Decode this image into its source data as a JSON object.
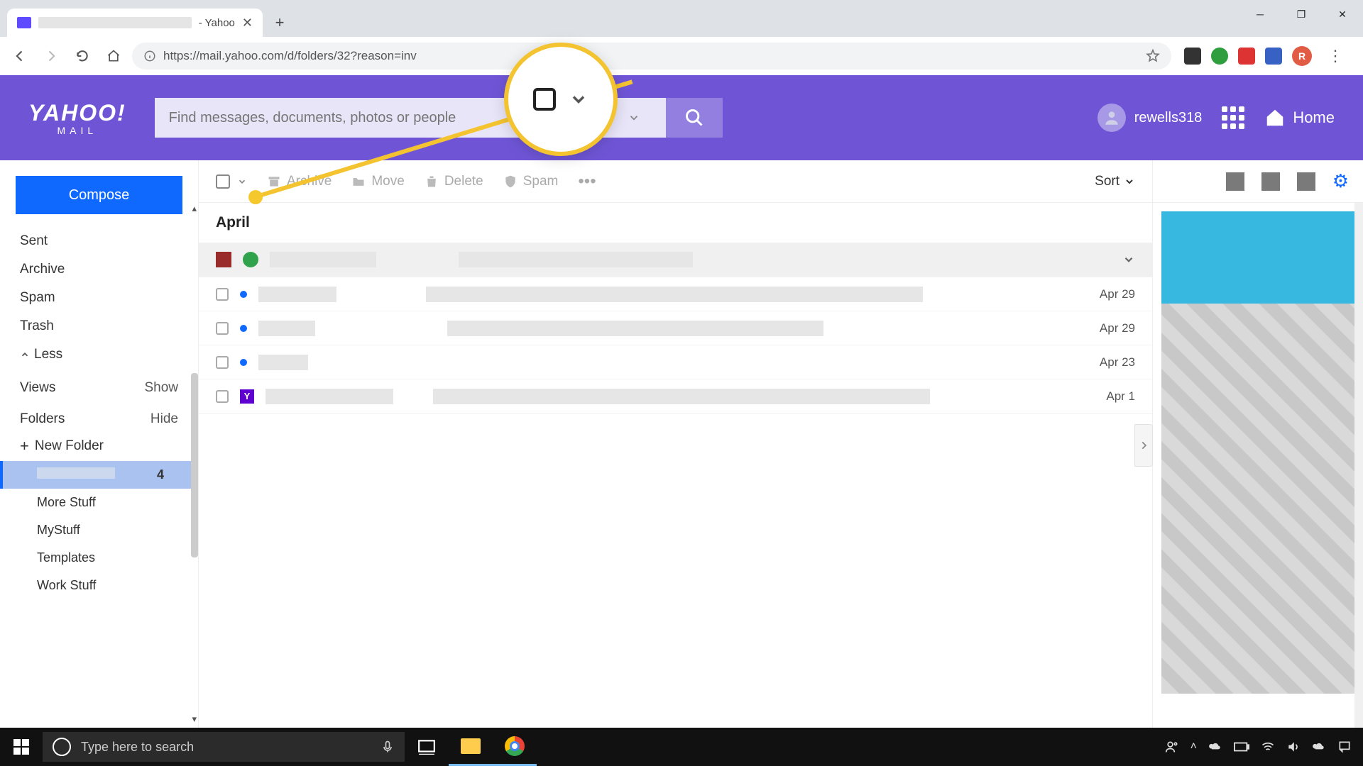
{
  "browser": {
    "tab_suffix": " - Yahoo",
    "url": "https://mail.yahoo.com/d/folders/32?reason=inv",
    "profile_initial": "R"
  },
  "yahoo": {
    "brand": "YAHOO!",
    "brand_sub": "MAIL",
    "search_placeholder": "Find messages, documents, photos or people",
    "username": "rewells318",
    "home_label": "Home"
  },
  "sidebar": {
    "compose": "Compose",
    "system_folders": [
      "Sent",
      "Archive",
      "Spam",
      "Trash"
    ],
    "less_label": "Less",
    "views_label": "Views",
    "views_action": "Show",
    "folders_label": "Folders",
    "folders_action": "Hide",
    "new_folder": "New Folder",
    "active_count": "4",
    "user_folders": [
      "More Stuff",
      "MyStuff",
      "Templates",
      "Work Stuff"
    ]
  },
  "toolbar": {
    "archive": "Archive",
    "move": "Move",
    "delete": "Delete",
    "spam": "Spam",
    "sort": "Sort"
  },
  "messages": {
    "month": "April",
    "rows": [
      {
        "date": ""
      },
      {
        "date": "Apr 29"
      },
      {
        "date": "Apr 29"
      },
      {
        "date": "Apr 23"
      },
      {
        "date": "Apr 1"
      }
    ]
  },
  "taskbar": {
    "search_placeholder": "Type here to search"
  }
}
